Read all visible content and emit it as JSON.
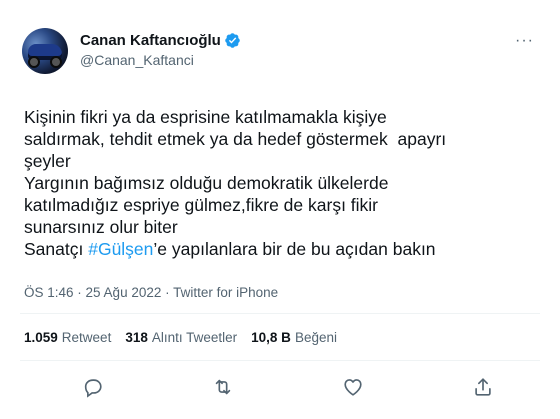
{
  "author": {
    "display_name": "Canan Kaftancıoğlu",
    "handle": "@Canan_Kaftanci",
    "verified": true
  },
  "more_icon": "more-horizontal-icon",
  "text_lines": [
    "Kişinin fikri ya da esprisine katılmamakla kişiye",
    "saldırmak, tehdit etmek ya da hedef göstermek  apayrı",
    "şeyler",
    "Yargının bağımsız olduğu demokratik ülkelerde",
    "katılmadığız espriye gülmez,fikre de karşı fikir",
    "sunarsınız olur biter"
  ],
  "last_line": {
    "prefix": "Sanatçı ",
    "hashtag": "#Gülşen",
    "suffix": "’e yapılanlara bir de bu açıdan bakın"
  },
  "meta": {
    "time": "ÖS 1:46",
    "separator": " · ",
    "date": "25 Ağu 2022",
    "source": "Twitter for iPhone"
  },
  "stats": [
    {
      "value": "1.059",
      "label": "Retweet"
    },
    {
      "value": "318",
      "label": "Alıntı Tweetler"
    },
    {
      "value": "10,8 B",
      "label": "Beğeni"
    }
  ],
  "actions": [
    "reply-icon",
    "retweet-icon",
    "like-icon",
    "share-icon"
  ],
  "colors": {
    "accent": "#1d9bf0",
    "secondary_text": "#536471",
    "primary_text": "#0f1419"
  }
}
